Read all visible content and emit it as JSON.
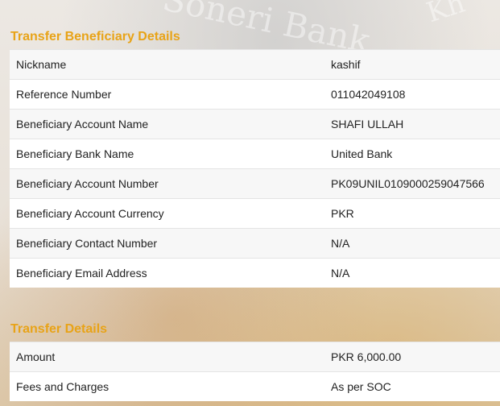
{
  "watermark_text": "Soneri Bank",
  "beneficiary_section": {
    "title": "Transfer Beneficiary Details",
    "rows": [
      {
        "label": "Nickname",
        "value": "kashif"
      },
      {
        "label": "Reference Number",
        "value": "011042049108"
      },
      {
        "label": "Beneficiary Account Name",
        "value": "SHAFI ULLAH"
      },
      {
        "label": "Beneficiary Bank Name",
        "value": "United Bank"
      },
      {
        "label": "Beneficiary Account Number",
        "value": "PK09UNIL0109000259047566"
      },
      {
        "label": "Beneficiary Account Currency",
        "value": "PKR"
      },
      {
        "label": "Beneficiary Contact Number",
        "value": "N/A"
      },
      {
        "label": "Beneficiary Email Address",
        "value": "N/A"
      }
    ]
  },
  "transfer_section": {
    "title": "Transfer Details",
    "rows": [
      {
        "label": "Amount",
        "value": "PKR 6,000.00"
      },
      {
        "label": "Fees and Charges",
        "value": "As per SOC"
      }
    ]
  },
  "colors": {
    "heading": "#e8a317",
    "row_odd": "#f7f7f7",
    "row_even": "#ffffff"
  }
}
